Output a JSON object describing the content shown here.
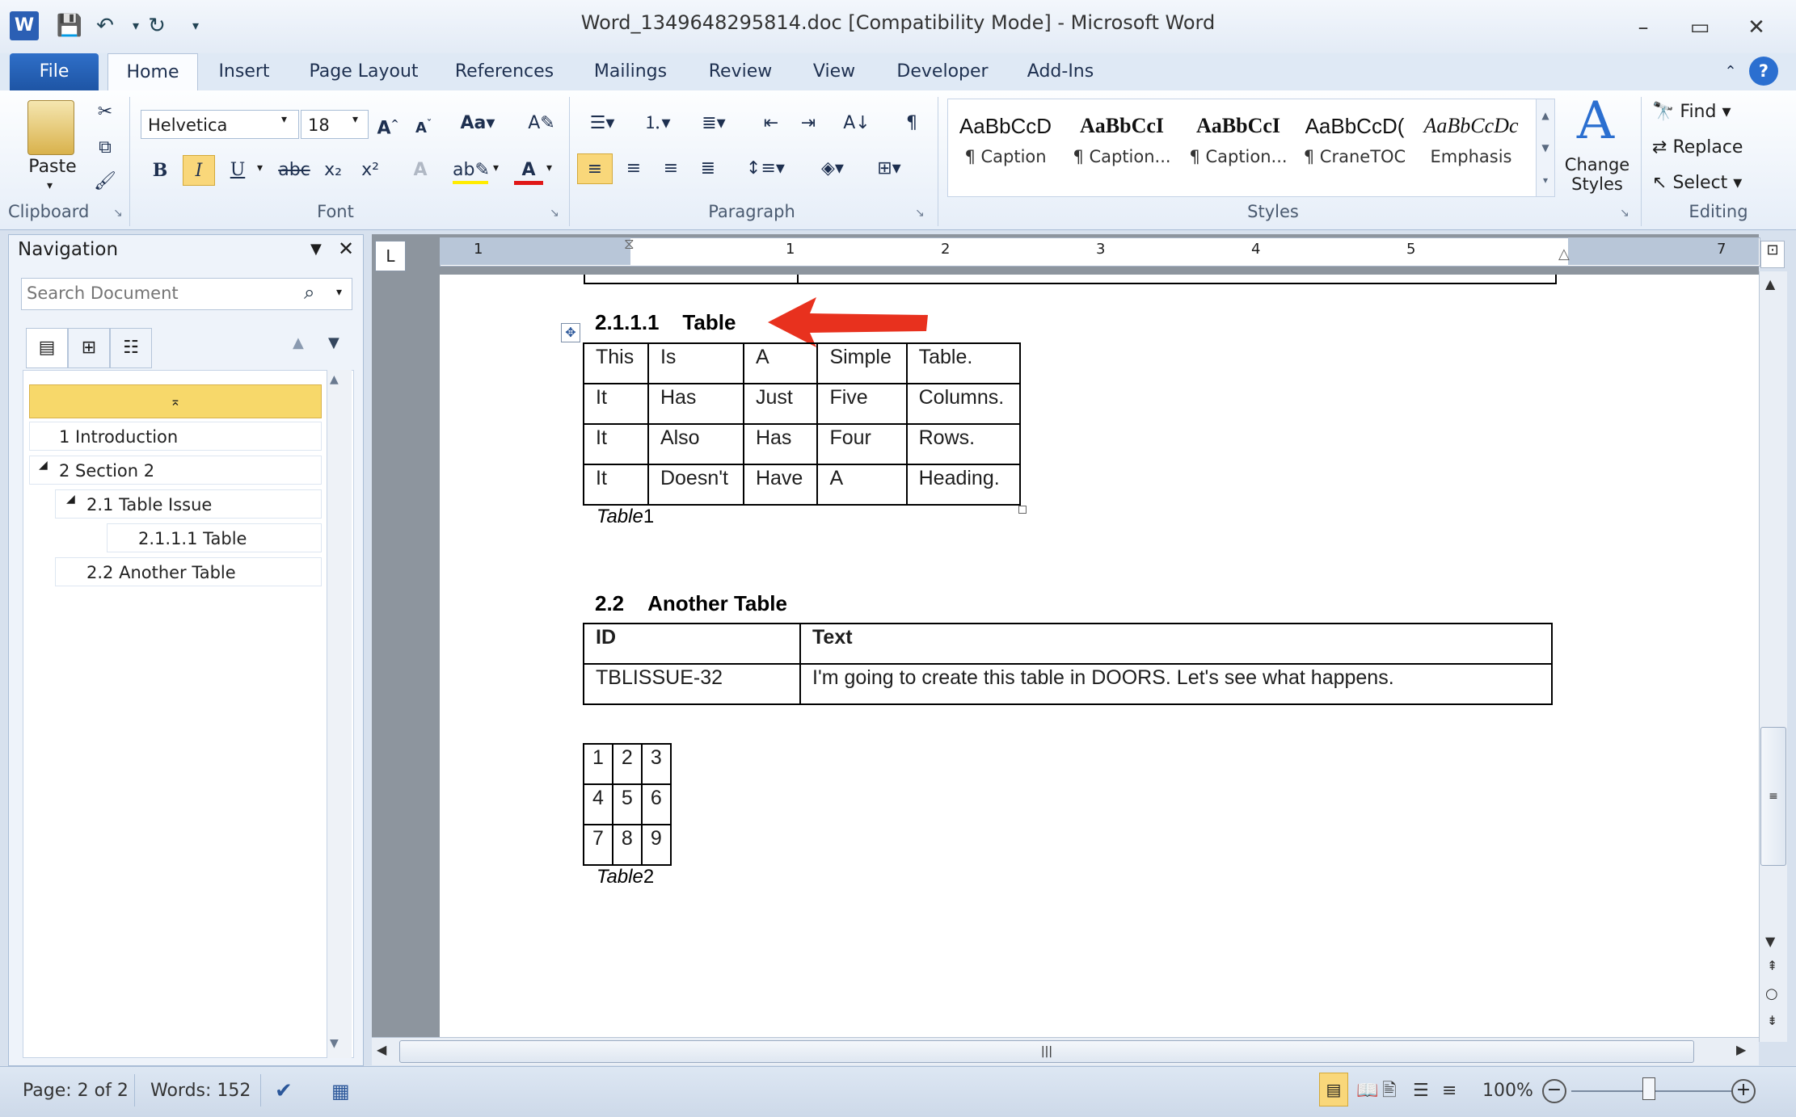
{
  "window": {
    "title": "Word_1349648295814.doc [Compatibility Mode]  -  Microsoft Word"
  },
  "tabs": [
    "File",
    "Home",
    "Insert",
    "Page Layout",
    "References",
    "Mailings",
    "Review",
    "View",
    "Developer",
    "Add-Ins"
  ],
  "ribbon": {
    "clipboard": {
      "paste_label": "Paste",
      "group_label": "Clipboard"
    },
    "font": {
      "name": "Helvetica",
      "size": "18",
      "group_label": "Font"
    },
    "paragraph": {
      "group_label": "Paragraph"
    },
    "styles": {
      "group_label": "Styles",
      "items": [
        {
          "sample": "AaBbCcD",
          "name": "¶ Caption"
        },
        {
          "sample": "AaBbCcI",
          "name": "¶ Caption..."
        },
        {
          "sample": "AaBbCcI",
          "name": "¶ Caption..."
        },
        {
          "sample": "AaBbCcD(",
          "name": "¶ CraneTOC"
        },
        {
          "sample": "AaBbCcDc",
          "name": "Emphasis"
        }
      ],
      "change_styles_label": "Change Styles"
    },
    "editing": {
      "group_label": "Editing",
      "find": "Find",
      "replace": "Replace",
      "select": "Select"
    }
  },
  "nav": {
    "title": "Navigation",
    "search_placeholder": "Search Document",
    "items": [
      {
        "label": "1 Introduction"
      },
      {
        "label": "2 Section 2"
      },
      {
        "label": "2.1 Table Issue"
      },
      {
        "label": "2.1.1.1 Table"
      },
      {
        "label": "2.2 Another Table"
      }
    ]
  },
  "ruler": {
    "numbers": [
      "1",
      "1",
      "2",
      "3",
      "4",
      "5",
      "7"
    ]
  },
  "document": {
    "heading1": {
      "num": "2.1.1.1",
      "text": "Table"
    },
    "table1": [
      [
        "This",
        "Is",
        "A",
        "Simple",
        "Table."
      ],
      [
        "It",
        "Has",
        "Just",
        "Five",
        "Columns."
      ],
      [
        "It",
        "Also",
        "Has",
        "Four",
        "Rows."
      ],
      [
        "It",
        "Doesn't",
        "Have",
        "A",
        "Heading."
      ]
    ],
    "caption1": {
      "label": "Table",
      "num": "1"
    },
    "heading2": {
      "num": "2.2",
      "text": "Another Table"
    },
    "table2": {
      "headers": [
        "ID",
        "Text"
      ],
      "rows": [
        [
          "TBLISSUE-32",
          "I'm going to create this table in DOORS. Let's see what happens."
        ]
      ]
    },
    "table3": [
      [
        "1",
        "2",
        "3"
      ],
      [
        "4",
        "5",
        "6"
      ],
      [
        "7",
        "8",
        "9"
      ]
    ],
    "caption2": {
      "label": "Table",
      "num": "2"
    }
  },
  "status": {
    "page": "Page: 2 of 2",
    "words": "Words: 152",
    "zoom": "100%"
  },
  "colors": {
    "accent": "#2b579a",
    "arrow": "#e8311e",
    "nav_selected": "#f7d86a"
  }
}
